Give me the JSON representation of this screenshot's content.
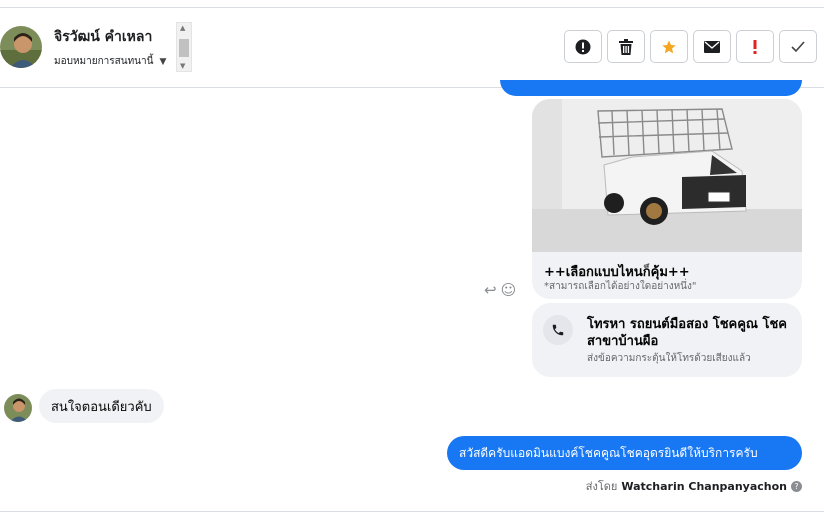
{
  "header": {
    "contact_name": "จิรวัฒน์ คำเหลา",
    "assign_label": "มอบหมายการสนทนานี้",
    "actions": [
      {
        "name": "report-button",
        "icon": "alert-circle-icon"
      },
      {
        "name": "delete-button",
        "icon": "trash-icon"
      },
      {
        "name": "star-button",
        "icon": "star-icon",
        "color": "#f5a623"
      },
      {
        "name": "mark-unread-button",
        "icon": "envelope-icon"
      },
      {
        "name": "spam-button",
        "icon": "exclamation-icon",
        "color": "#e02424"
      },
      {
        "name": "done-button",
        "icon": "check-icon"
      }
    ]
  },
  "messages": {
    "card": {
      "title": "++เลือกแบบไหนก็คุ้ม++",
      "subtitle": "*สามารถเลือกได้อย่างใดอย่างหนึ่ง\""
    },
    "call_card": {
      "title": "โทรหา รถยนต์มือสอง โชคคูณ โชค สาขาบ้านผือ",
      "subtitle": "ส่งข้อความกระตุ้นให้โทรด้วยเสียงแล้ว"
    },
    "incoming": {
      "text": "สนใจตอนเดียวคับ"
    },
    "outgoing": {
      "text": "สวัสดีครับแอดมินแบงค์โชคคูณโชคอุดรยินดีให้บริการครับ"
    },
    "sent_by": {
      "prefix": "ส่งโดย",
      "name": "Watcharin Chanpanyachon",
      "help": "?"
    }
  },
  "colors": {
    "accent_blue": "#1877f2",
    "bubble_grey": "#f0f2f5",
    "star": "#f5a623",
    "alert": "#e02424"
  }
}
